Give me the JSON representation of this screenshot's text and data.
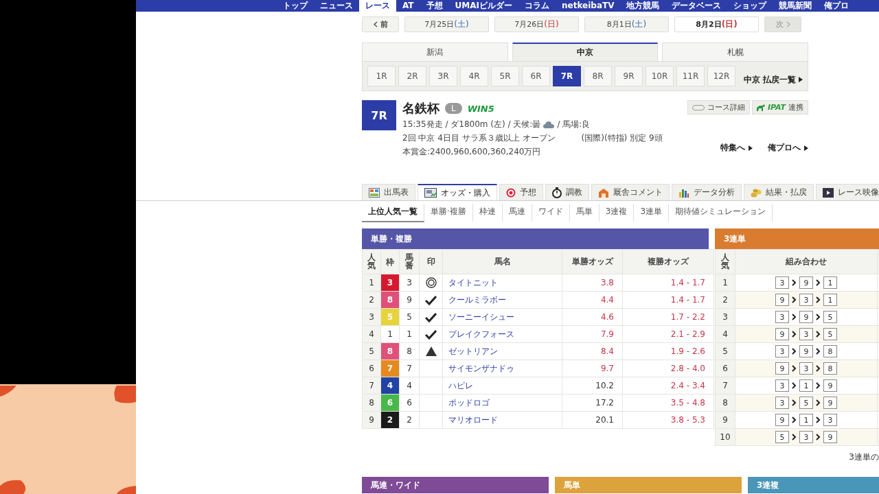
{
  "global_nav": [
    {
      "label": "トップ",
      "selected": false
    },
    {
      "label": "ニュース",
      "selected": false
    },
    {
      "label": "レース",
      "selected": true
    },
    {
      "label": "AT",
      "selected": false
    },
    {
      "label": "予想",
      "selected": false
    },
    {
      "label": "UMAIビルダー",
      "selected": false
    },
    {
      "label": "コラム",
      "selected": false
    },
    {
      "label": "netkeibaTV",
      "selected": false
    },
    {
      "label": "地方競馬",
      "selected": false
    },
    {
      "label": "データベース",
      "selected": false
    },
    {
      "label": "ショップ",
      "selected": false
    },
    {
      "label": "競馬新聞",
      "selected": false
    },
    {
      "label": "俺プロ",
      "selected": false
    }
  ],
  "date_nav": {
    "prev": "前",
    "next": "次",
    "next_disabled": true,
    "dates": [
      {
        "date": "7月25日",
        "weekday": "(土)",
        "color": "#3a6fb0",
        "selected": false
      },
      {
        "date": "7月26日",
        "weekday": "(日)",
        "color": "#c23a3a",
        "selected": false
      },
      {
        "date": "8月1日",
        "weekday": "(土)",
        "color": "#3a6fb0",
        "selected": false
      },
      {
        "date": "8月2日",
        "weekday": "(日)",
        "color": "#c23a3a",
        "selected": true
      }
    ]
  },
  "venue_tabs": [
    {
      "label": "新潟",
      "selected": false
    },
    {
      "label": "中京",
      "selected": true
    },
    {
      "label": "札幌",
      "selected": false
    }
  ],
  "race_numbers": [
    {
      "label": "1R",
      "selected": false
    },
    {
      "label": "2R",
      "selected": false
    },
    {
      "label": "3R",
      "selected": false
    },
    {
      "label": "4R",
      "selected": false
    },
    {
      "label": "5R",
      "selected": false
    },
    {
      "label": "6R",
      "selected": false
    },
    {
      "label": "7R",
      "selected": true
    },
    {
      "label": "8R",
      "selected": false
    },
    {
      "label": "9R",
      "selected": false
    },
    {
      "label": "10R",
      "selected": false
    },
    {
      "label": "11R",
      "selected": false
    },
    {
      "label": "12R",
      "selected": false
    }
  ],
  "payout_link": "中京 払戻一覧",
  "race": {
    "number": "7R",
    "name": "名鉄杯",
    "grade": "L",
    "win5": "WIN5",
    "info": "15:35発走 / ダ1800m (左) / 天候:曇",
    "track": "/ 馬場:良",
    "details": "2回 中京 4日目 サラ系３歳以上 オープン",
    "conditions": "(国際)(特指) 別定 9頭",
    "prize": "本賞金:2400,960,600,360,240万円",
    "course_button": "コース詳細",
    "ipat_logo": "IPAT",
    "ipat_label": "連携",
    "links": [
      "特集へ",
      "俺プロへ"
    ]
  },
  "main_tabs": [
    {
      "label": "出馬表",
      "kind": "table",
      "selected": false
    },
    {
      "label": "オッズ・購入",
      "kind": "odds",
      "selected": true
    },
    {
      "label": "予想",
      "kind": "target",
      "selected": false
    },
    {
      "label": "調教",
      "kind": "stopwatch",
      "selected": false
    },
    {
      "label": "厩舎コメント",
      "kind": "stable",
      "selected": false
    },
    {
      "label": "データ分析",
      "kind": "chart",
      "selected": false
    },
    {
      "label": "結果・払戻",
      "kind": "coins",
      "selected": false
    },
    {
      "label": "レース映像",
      "kind": "video",
      "selected": false
    }
  ],
  "sub_tabs": [
    {
      "label": "上位人気一覧",
      "selected": true
    },
    {
      "label": "単勝·複勝",
      "selected": false
    },
    {
      "label": "枠連",
      "selected": false
    },
    {
      "label": "馬連",
      "selected": false
    },
    {
      "label": "ワイド",
      "selected": false
    },
    {
      "label": "馬単",
      "selected": false
    },
    {
      "label": "3連複",
      "selected": false
    },
    {
      "label": "3連単",
      "selected": false
    },
    {
      "label": "期待値シミュレーション",
      "selected": false
    }
  ],
  "win_place": {
    "title": "単勝・複勝",
    "columns": [
      "人気",
      "枠",
      "馬番",
      "印",
      "馬名",
      "単勝オッズ",
      "複勝オッズ"
    ],
    "rows": [
      {
        "rank": "1",
        "frame": "3",
        "color": "#d7192f",
        "number": "3",
        "kind": "double-circle",
        "horse": "タイトニット",
        "win": "3.8",
        "win_popular": true,
        "place": "1.4 - 1.7"
      },
      {
        "rank": "2",
        "frame": "8",
        "color": "#e0517a",
        "number": "9",
        "kind": "check",
        "horse": "クールミラボー",
        "win": "4.4",
        "win_popular": true,
        "place": "1.4 - 1.7"
      },
      {
        "rank": "3",
        "frame": "5",
        "color": "#e8d43a",
        "number": "5",
        "kind": "check",
        "horse": "ソーニーイシュー",
        "win": "4.6",
        "win_popular": true,
        "place": "1.7 - 2.2"
      },
      {
        "rank": "4",
        "frame": "1",
        "color": "#ffffff",
        "number": "1",
        "kind": "check",
        "horse": "ブレイクフォース",
        "win": "7.9",
        "win_popular": true,
        "place": "2.1 - 2.9"
      },
      {
        "rank": "5",
        "frame": "8",
        "color": "#e0517a",
        "number": "8",
        "kind": "triangle",
        "horse": "ゼットリアン",
        "win": "8.4",
        "win_popular": true,
        "place": "1.9 - 2.6"
      },
      {
        "rank": "6",
        "frame": "7",
        "color": "#e68a1f",
        "number": "7",
        "kind": "plain",
        "horse": "サイモンザナドゥ",
        "win": "9.7",
        "win_popular": true,
        "place": "2.8 - 4.0"
      },
      {
        "rank": "7",
        "frame": "4",
        "color": "#2143a5",
        "number": "4",
        "kind": "plain",
        "horse": "ハピレ",
        "win": "10.2",
        "win_popular": false,
        "place": "2.4 - 3.4"
      },
      {
        "rank": "8",
        "frame": "6",
        "color": "#49b84a",
        "number": "6",
        "kind": "plain",
        "horse": "ポッドロゴ",
        "win": "17.2",
        "win_popular": false,
        "place": "3.5 - 4.8"
      },
      {
        "rank": "9",
        "frame": "2",
        "color": "#1a1a1a",
        "number": "2",
        "kind": "plain",
        "horse": "マリオロード",
        "win": "20.1",
        "win_popular": false,
        "place": "3.8 - 5.3"
      }
    ]
  },
  "trifecta": {
    "title": "3連単",
    "columns": [
      "人気",
      "組み合わせ"
    ],
    "rows": [
      {
        "rank": "1",
        "combo": [
          "3",
          "9",
          "1"
        ]
      },
      {
        "rank": "2",
        "combo": [
          "9",
          "3",
          "1"
        ]
      },
      {
        "rank": "3",
        "combo": [
          "3",
          "9",
          "5"
        ]
      },
      {
        "rank": "4",
        "combo": [
          "9",
          "3",
          "5"
        ]
      },
      {
        "rank": "5",
        "combo": [
          "3",
          "9",
          "8"
        ]
      },
      {
        "rank": "6",
        "combo": [
          "9",
          "3",
          "8"
        ]
      },
      {
        "rank": "7",
        "combo": [
          "3",
          "1",
          "9"
        ]
      },
      {
        "rank": "8",
        "combo": [
          "3",
          "5",
          "9"
        ]
      },
      {
        "rank": "9",
        "combo": [
          "9",
          "1",
          "3"
        ]
      },
      {
        "rank": "10",
        "combo": [
          "5",
          "3",
          "9"
        ]
      }
    ],
    "note": "3連単の"
  },
  "section_headers": [
    {
      "title": "馬連・ワイド",
      "kind": "quinella"
    },
    {
      "title": "馬単",
      "kind": "exacta"
    },
    {
      "title": "3連複",
      "kind": "trio"
    }
  ]
}
